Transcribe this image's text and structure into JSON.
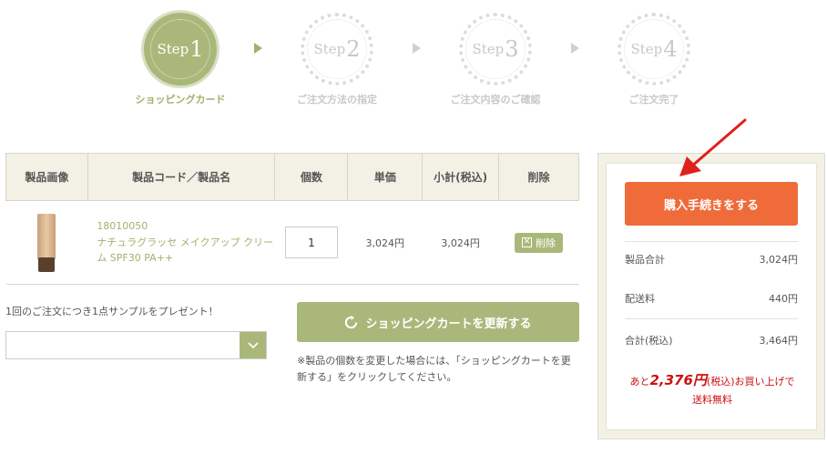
{
  "steps": [
    {
      "num": "1",
      "word": "Step",
      "label": "ショッピングカード"
    },
    {
      "num": "2",
      "word": "Step",
      "label": "ご注文方法の指定"
    },
    {
      "num": "3",
      "word": "Step",
      "label": "ご注文内容のご確認"
    },
    {
      "num": "4",
      "word": "Step",
      "label": "ご注文完了"
    }
  ],
  "table": {
    "headers": [
      "製品画像",
      "製品コード／製品名",
      "個数",
      "単価",
      "小計(税込)",
      "削除"
    ],
    "rows": [
      {
        "code": "18010050",
        "name": "ナチュラグラッセ メイクアップ クリーム SPF30 PA++",
        "quantity": "1",
        "unit_price": "3,024円",
        "subtotal": "3,024円",
        "delete_label": "削除"
      }
    ]
  },
  "sample": {
    "text": "1回のご注文につき1点サンプルをプレゼント！",
    "selected": ""
  },
  "update_button": "ショッピングカートを更新する",
  "update_note": "※製品の個数を変更した場合には、「ショッピングカートを更新する」をクリックしてください。",
  "summary": {
    "buy_button": "購入手続きをする",
    "product_total_label": "製品合計",
    "product_total_value": "3,024円",
    "shipping_label": "配送料",
    "shipping_value": "440円",
    "total_label": "合計(税込)",
    "total_value": "3,464円",
    "promo_prefix": "あと",
    "promo_amount": "2,376円",
    "promo_tax": "(税込)",
    "promo_suffix": "お買い上げで",
    "promo_line2": "送料無料"
  },
  "colors": {
    "accent_green": "#a9b87a",
    "buy_orange": "#ef6b3a",
    "promo_red": "#cc1010"
  }
}
